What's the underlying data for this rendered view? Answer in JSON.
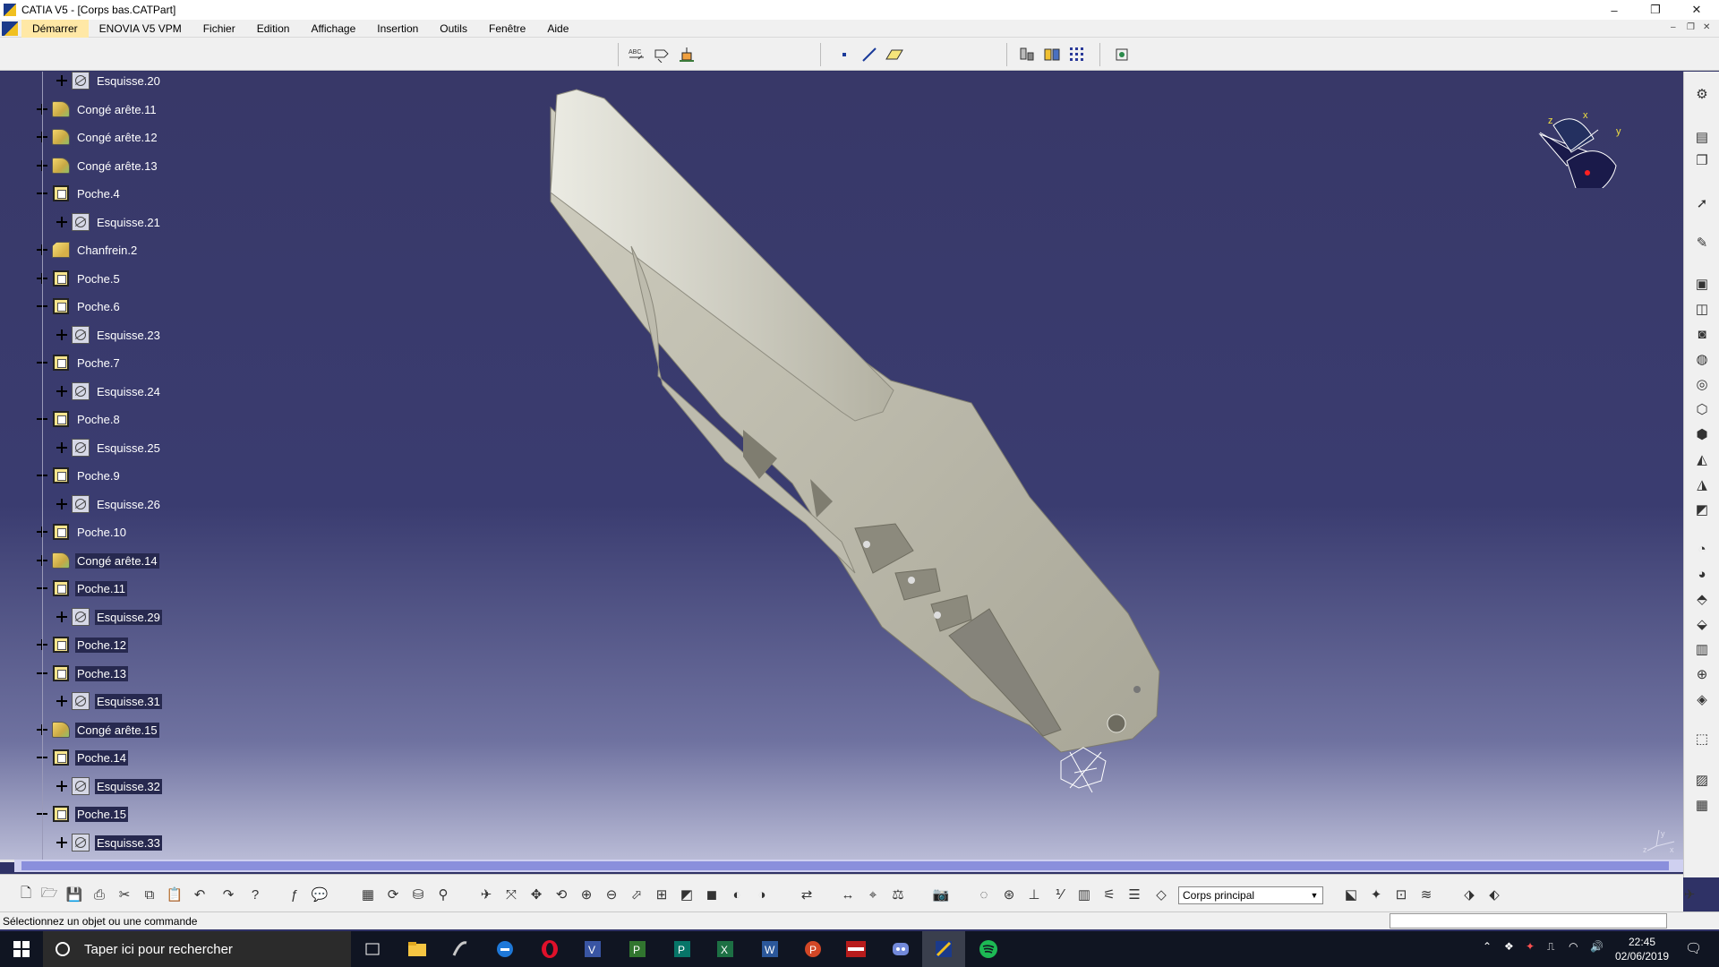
{
  "window": {
    "title": "CATIA V5 - [Corps bas.CATPart]",
    "minimize": "–",
    "maximize": "❐",
    "close": "✕"
  },
  "menu": {
    "items": [
      "Démarrer",
      "ENOVIA V5 VPM",
      "Fichier",
      "Edition",
      "Affichage",
      "Insertion",
      "Outils",
      "Fenêtre",
      "Aide"
    ],
    "active": "Démarrer"
  },
  "tree": {
    "items": [
      {
        "label": "Esquisse.20",
        "type": "sketch"
      },
      {
        "label": "Congé arête.11",
        "type": "fillet"
      },
      {
        "label": "Congé arête.12",
        "type": "fillet"
      },
      {
        "label": "Congé arête.13",
        "type": "fillet"
      },
      {
        "label": "Poche.4",
        "type": "pocket"
      },
      {
        "label": "Esquisse.21",
        "type": "sketch"
      },
      {
        "label": "Chanfrein.2",
        "type": "chamfer"
      },
      {
        "label": "Poche.5",
        "type": "pocket"
      },
      {
        "label": "Poche.6",
        "type": "pocket"
      },
      {
        "label": "Esquisse.23",
        "type": "sketch"
      },
      {
        "label": "Poche.7",
        "type": "pocket"
      },
      {
        "label": "Esquisse.24",
        "type": "sketch"
      },
      {
        "label": "Poche.8",
        "type": "pocket"
      },
      {
        "label": "Esquisse.25",
        "type": "sketch"
      },
      {
        "label": "Poche.9",
        "type": "pocket"
      },
      {
        "label": "Esquisse.26",
        "type": "sketch"
      },
      {
        "label": "Poche.10",
        "type": "pocket"
      },
      {
        "label": "Congé arête.14",
        "type": "fillet"
      },
      {
        "label": "Poche.11",
        "type": "pocket"
      },
      {
        "label": "Esquisse.29",
        "type": "sketch"
      },
      {
        "label": "Poche.12",
        "type": "pocket"
      },
      {
        "label": "Poche.13",
        "type": "pocket"
      },
      {
        "label": "Esquisse.31",
        "type": "sketch"
      },
      {
        "label": "Congé arête.15",
        "type": "fillet"
      },
      {
        "label": "Poche.14",
        "type": "pocket"
      },
      {
        "label": "Esquisse.32",
        "type": "sketch"
      },
      {
        "label": "Poche.15",
        "type": "pocket"
      },
      {
        "label": "Esquisse.33",
        "type": "sketch"
      }
    ]
  },
  "compass": {
    "x": "x",
    "y": "y",
    "z": "z"
  },
  "axis_glyph": {
    "x": "x",
    "y": "y",
    "z": "z"
  },
  "toolbar": {
    "body_select": "Corps principal"
  },
  "status": {
    "message": "Sélectionnez un objet ou une commande"
  },
  "taskbar": {
    "search_placeholder": "Taper ici pour rechercher",
    "time": "22:45",
    "date": "02/06/2019"
  },
  "colors": {
    "viewport_bg": "#3a3c70",
    "part": "#c8c6b6",
    "tree_text": "#ffffff",
    "taskbar": "#101522"
  }
}
